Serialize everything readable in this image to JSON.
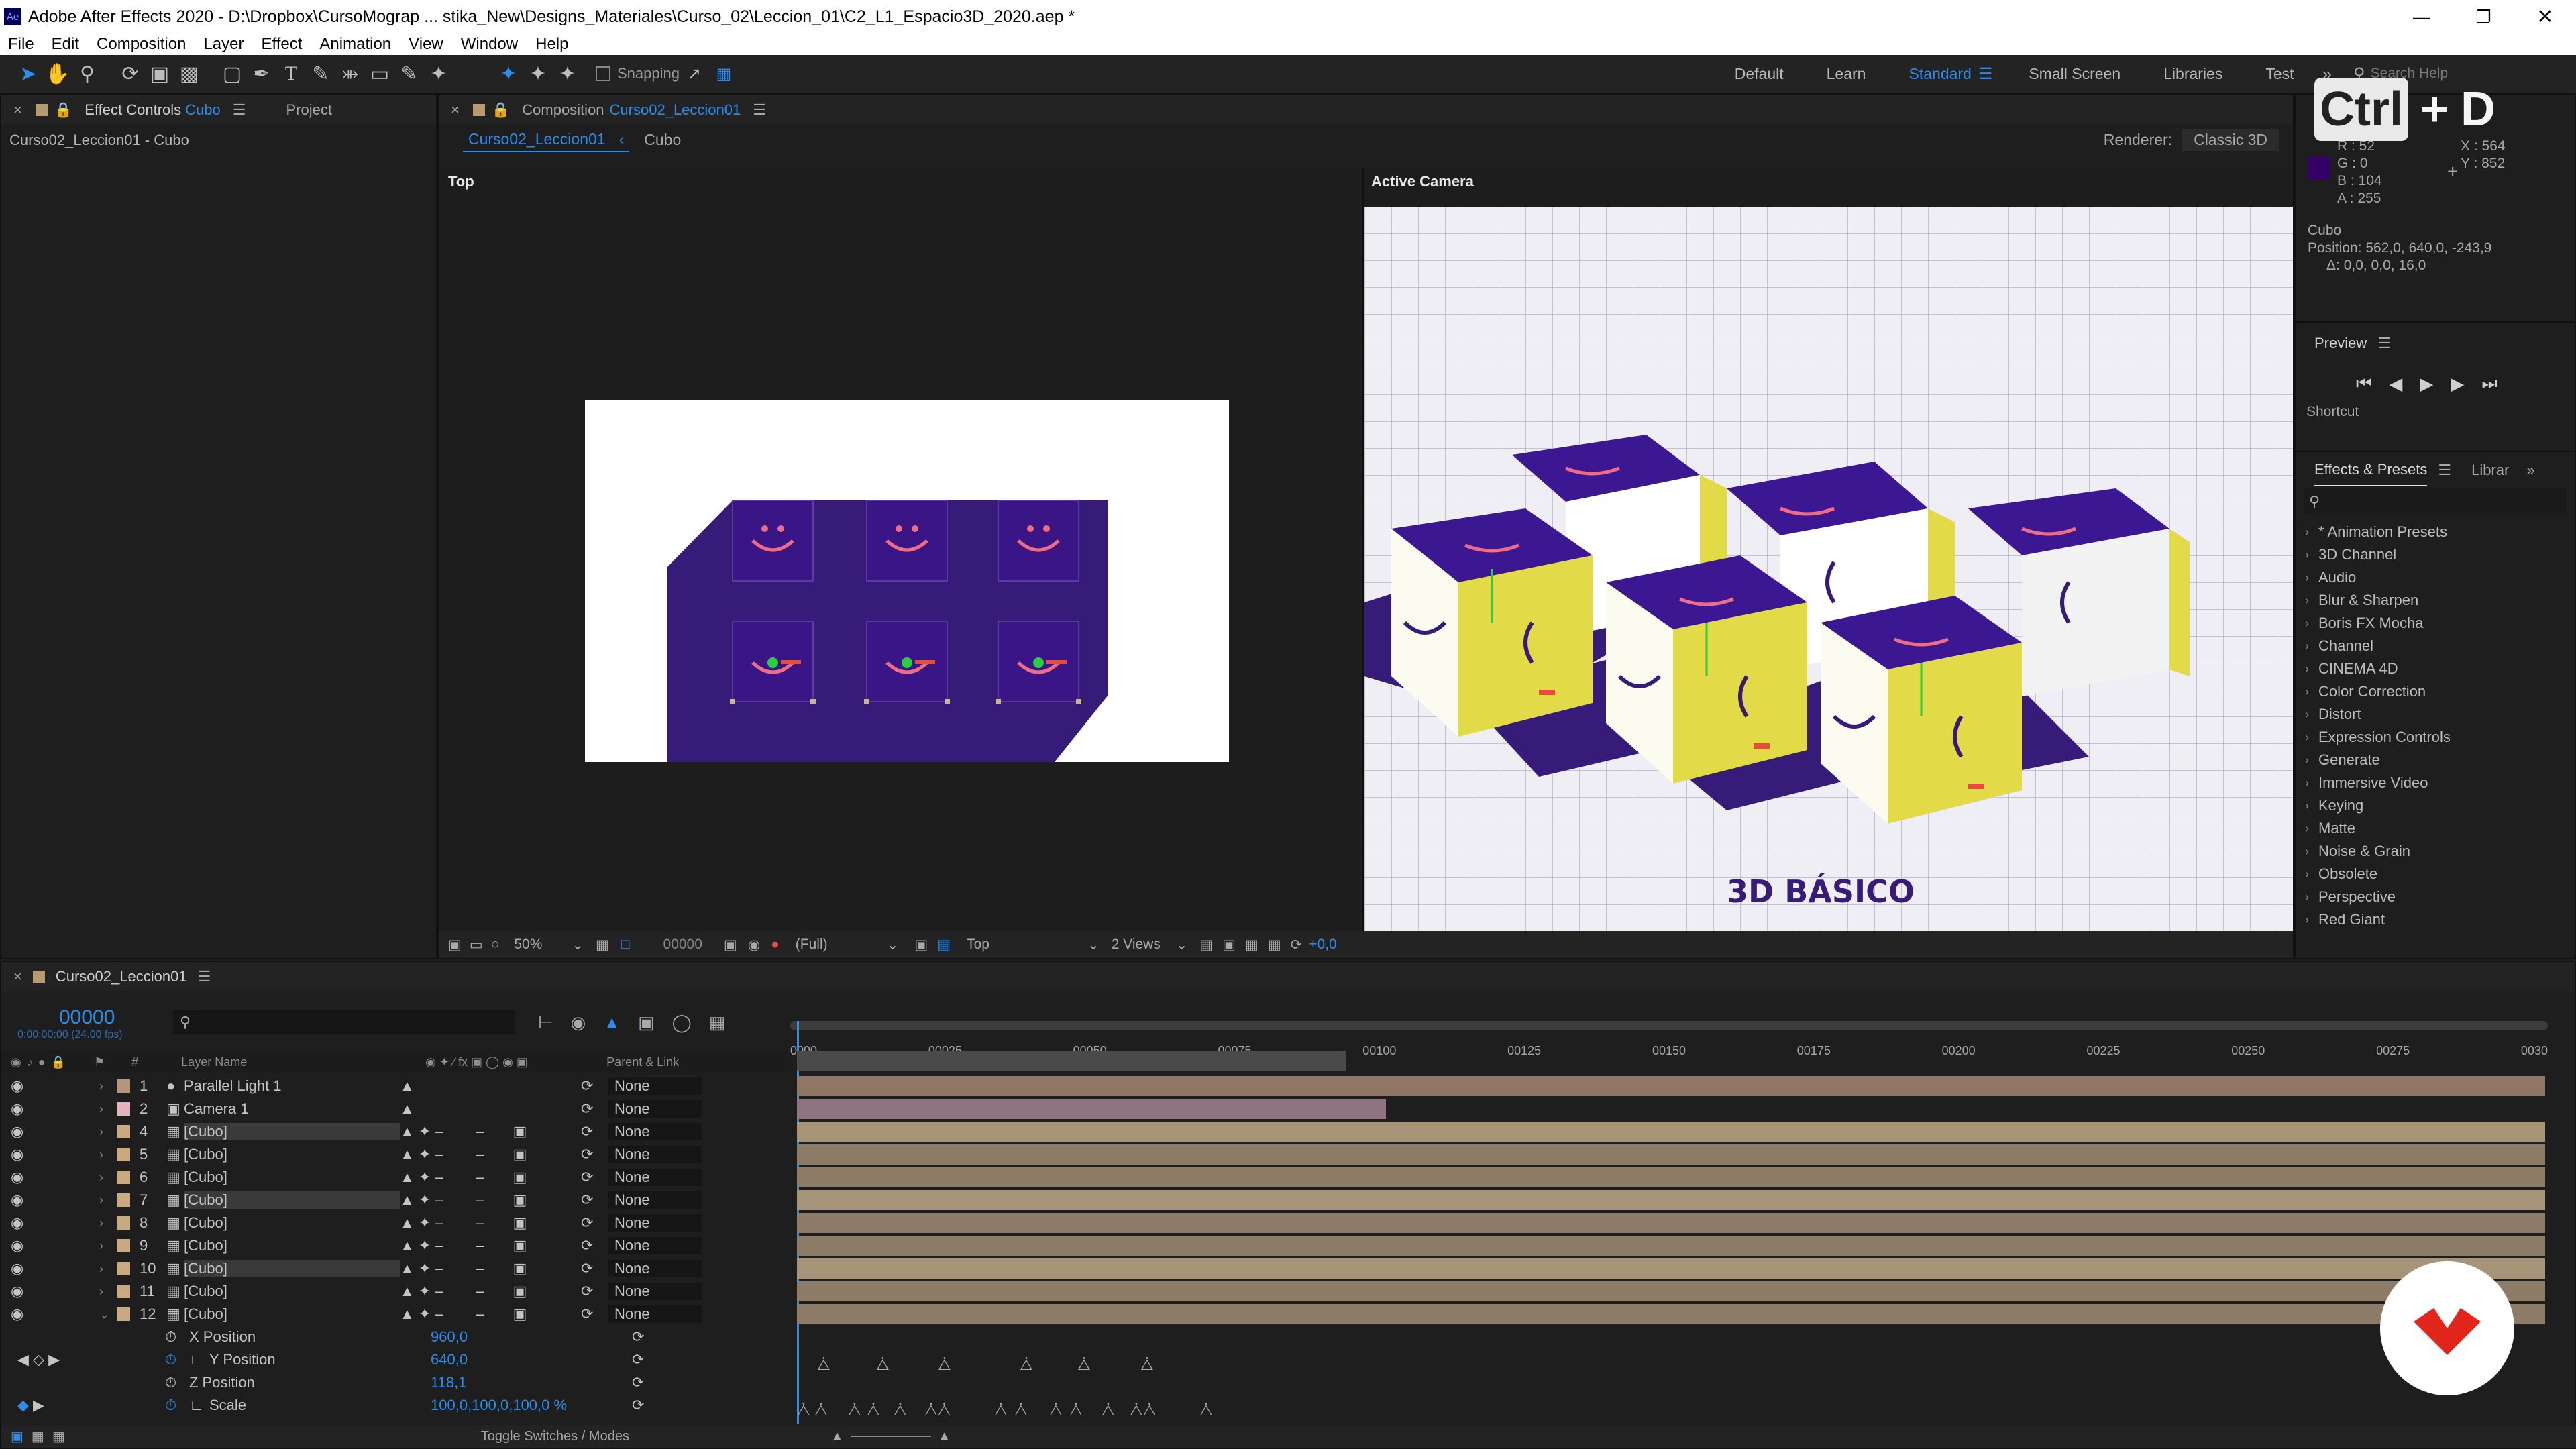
{
  "window": {
    "app_icon": "Ae",
    "title": "Adobe After Effects 2020 - D:\\Dropbox\\CursoMograp ... stika_New\\Designs_Materiales\\Curso_02\\Leccion_01\\C2_L1_Espacio3D_2020.aep *"
  },
  "menu": [
    "File",
    "Edit",
    "Composition",
    "Layer",
    "Effect",
    "Animation",
    "View",
    "Window",
    "Help"
  ],
  "toolbar": {
    "snapping": "Snapping",
    "workspaces": [
      "Default",
      "Learn",
      "Standard",
      "Small Screen",
      "Libraries",
      "Test"
    ],
    "search_placeholder": "Search Help"
  },
  "shortcut_overlay": {
    "key1": "Ctrl",
    "plus": "+",
    "key2": "D"
  },
  "effect_controls": {
    "tab": "Effect Controls",
    "layer": "Cubo",
    "project_tab": "Project",
    "subtitle": "Curso02_Leccion01 - Cubo"
  },
  "composition": {
    "tab_prefix": "Composition",
    "name": "Curso02_Leccion01",
    "nav_comp": "Curso02_Leccion01",
    "nav_layer": "Cubo",
    "renderer_label": "Renderer:",
    "renderer": "Classic 3D",
    "left_view": "Top",
    "right_view": "Active Camera",
    "title_3d": "3D BÁSICO"
  },
  "viewer_footer": {
    "zoom": "50%",
    "timecode": "00000",
    "resolution": "(Full)",
    "view": "Top",
    "views": "2 Views",
    "exposure": "+0,0"
  },
  "info": {
    "r": "R : 52",
    "g": "G : 0",
    "b": "B : 104",
    "a": "A : 255",
    "x": "X : 564",
    "y": "Y : 852",
    "layer": "Cubo",
    "position": "Position: 562,0, 640,0, -243,9",
    "delta": "Δ: 0,0, 0,0, 16,0"
  },
  "preview": {
    "title": "Preview",
    "shortcut": "Shortcut"
  },
  "effects_presets": {
    "tab": "Effects & Presets",
    "tab2": "Librar",
    "items": [
      "* Animation Presets",
      "3D Channel",
      "Audio",
      "Blur & Sharpen",
      "Boris FX Mocha",
      "Channel",
      "CINEMA 4D",
      "Color Correction",
      "Distort",
      "Expression Controls",
      "Generate",
      "Immersive Video",
      "Keying",
      "Matte",
      "Noise & Grain",
      "Obsolete",
      "Perspective",
      "Red Giant"
    ]
  },
  "timeline": {
    "comp": "Curso02_Leccion01",
    "timecode": "00000",
    "fps": "0:00:00:00 (24.00 fps)",
    "col_layer_name": "Layer Name",
    "col_parent": "Parent & Link",
    "toggle_label": "Toggle Switches / Modes",
    "ruler": [
      "0000",
      "00025",
      "00050",
      "00075",
      "00100",
      "00125",
      "00150",
      "00175",
      "00200",
      "00225",
      "00250",
      "00275",
      "0030"
    ],
    "layers": [
      {
        "num": "1",
        "name": "Parallel Light 1",
        "parent": "None",
        "color": "#b5967a"
      },
      {
        "num": "2",
        "name": "Camera 1",
        "parent": "None",
        "color": "#e7b2c0"
      },
      {
        "num": "4",
        "name": "[Cubo]",
        "parent": "None",
        "color": "#c9aa80"
      },
      {
        "num": "5",
        "name": "[Cubo]",
        "parent": "None",
        "color": "#c9aa80"
      },
      {
        "num": "6",
        "name": "[Cubo]",
        "parent": "None",
        "color": "#c9aa80"
      },
      {
        "num": "7",
        "name": "[Cubo]",
        "parent": "None",
        "color": "#c9aa80"
      },
      {
        "num": "8",
        "name": "[Cubo]",
        "parent": "None",
        "color": "#c9aa80"
      },
      {
        "num": "9",
        "name": "[Cubo]",
        "parent": "None",
        "color": "#c9aa80"
      },
      {
        "num": "10",
        "name": "[Cubo]",
        "parent": "None",
        "color": "#c9aa80"
      },
      {
        "num": "11",
        "name": "[Cubo]",
        "parent": "None",
        "color": "#c9aa80"
      },
      {
        "num": "12",
        "name": "[Cubo]",
        "parent": "None",
        "color": "#c9aa80"
      }
    ],
    "props": [
      {
        "name": "X Position",
        "value": "960,0"
      },
      {
        "name": "Y Position",
        "value": "640,0"
      },
      {
        "name": "Z Position",
        "value": "118,1"
      },
      {
        "name": "Scale",
        "value": "100,0,100,0,100,0 %"
      }
    ]
  }
}
